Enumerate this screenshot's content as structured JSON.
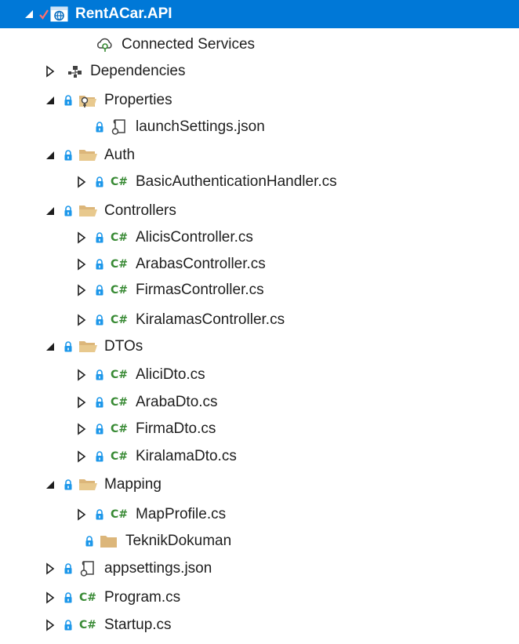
{
  "colors": {
    "selection": "#0078d7",
    "text": "#1e1e1e",
    "csharp": "#388a34",
    "folder": "#dcb67a",
    "lock": "#1c97ea"
  },
  "tree": {
    "rows": [
      {
        "label": "RentACar.API",
        "indent": 0,
        "expander": "expanded",
        "check": true,
        "icon": "web-project-icon",
        "selected": true
      },
      {
        "label": "Connected Services",
        "indent": 2,
        "expander": "none",
        "icon": "connected-services-icon"
      },
      {
        "label": "Dependencies",
        "indent": 1,
        "expander": "collapsed",
        "icon": "dependencies-icon"
      },
      {
        "label": "Properties",
        "indent": 1,
        "expander": "expanded",
        "lock": true,
        "icon": "properties-folder-icon"
      },
      {
        "label": "launchSettings.json",
        "indent": 2,
        "expander": "none",
        "lock": true,
        "icon": "json-file-icon"
      },
      {
        "label": "Auth",
        "indent": 1,
        "expander": "expanded",
        "lock": true,
        "icon": "folder-open-icon"
      },
      {
        "label": "BasicAuthenticationHandler.cs",
        "indent": 2,
        "expander": "collapsed",
        "lock": true,
        "icon": "csharp-file-icon"
      },
      {
        "label": "Controllers",
        "indent": 1,
        "expander": "expanded",
        "lock": true,
        "icon": "folder-open-icon"
      },
      {
        "label": "AlicisController.cs",
        "indent": 2,
        "expander": "collapsed",
        "lock": true,
        "icon": "csharp-file-icon"
      },
      {
        "label": "ArabasController.cs",
        "indent": 2,
        "expander": "collapsed",
        "lock": true,
        "icon": "csharp-file-icon"
      },
      {
        "label": "FirmasController.cs",
        "indent": 2,
        "expander": "collapsed",
        "lock": true,
        "icon": "csharp-file-icon"
      },
      {
        "label": "KiralamasController.cs",
        "indent": 2,
        "expander": "collapsed",
        "lock": true,
        "icon": "csharp-file-icon"
      },
      {
        "label": "DTOs",
        "indent": 1,
        "expander": "expanded",
        "lock": true,
        "icon": "folder-open-icon"
      },
      {
        "label": "AliciDto.cs",
        "indent": 2,
        "expander": "collapsed",
        "lock": true,
        "icon": "csharp-file-icon"
      },
      {
        "label": "ArabaDto.cs",
        "indent": 2,
        "expander": "collapsed",
        "lock": true,
        "icon": "csharp-file-icon"
      },
      {
        "label": "FirmaDto.cs",
        "indent": 2,
        "expander": "collapsed",
        "lock": true,
        "icon": "csharp-file-icon"
      },
      {
        "label": "KiralamaDto.cs",
        "indent": 2,
        "expander": "collapsed",
        "lock": true,
        "icon": "csharp-file-icon"
      },
      {
        "label": "Mapping",
        "indent": 1,
        "expander": "expanded",
        "lock": true,
        "icon": "folder-open-icon"
      },
      {
        "label": "MapProfile.cs",
        "indent": 2,
        "expander": "collapsed",
        "lock": true,
        "icon": "csharp-file-icon"
      },
      {
        "label": "TeknikDokuman",
        "indent": 1.5,
        "expander": "none",
        "lock": true,
        "icon": "folder-closed-icon"
      },
      {
        "label": "appsettings.json",
        "indent": 1,
        "expander": "collapsed",
        "lock": true,
        "icon": "json-file-icon"
      },
      {
        "label": "Program.cs",
        "indent": 1,
        "expander": "collapsed",
        "lock": true,
        "icon": "csharp-file-icon"
      },
      {
        "label": "Startup.cs",
        "indent": 1,
        "expander": "collapsed",
        "lock": true,
        "icon": "csharp-file-icon"
      }
    ],
    "csharp_glyph": "C#"
  }
}
